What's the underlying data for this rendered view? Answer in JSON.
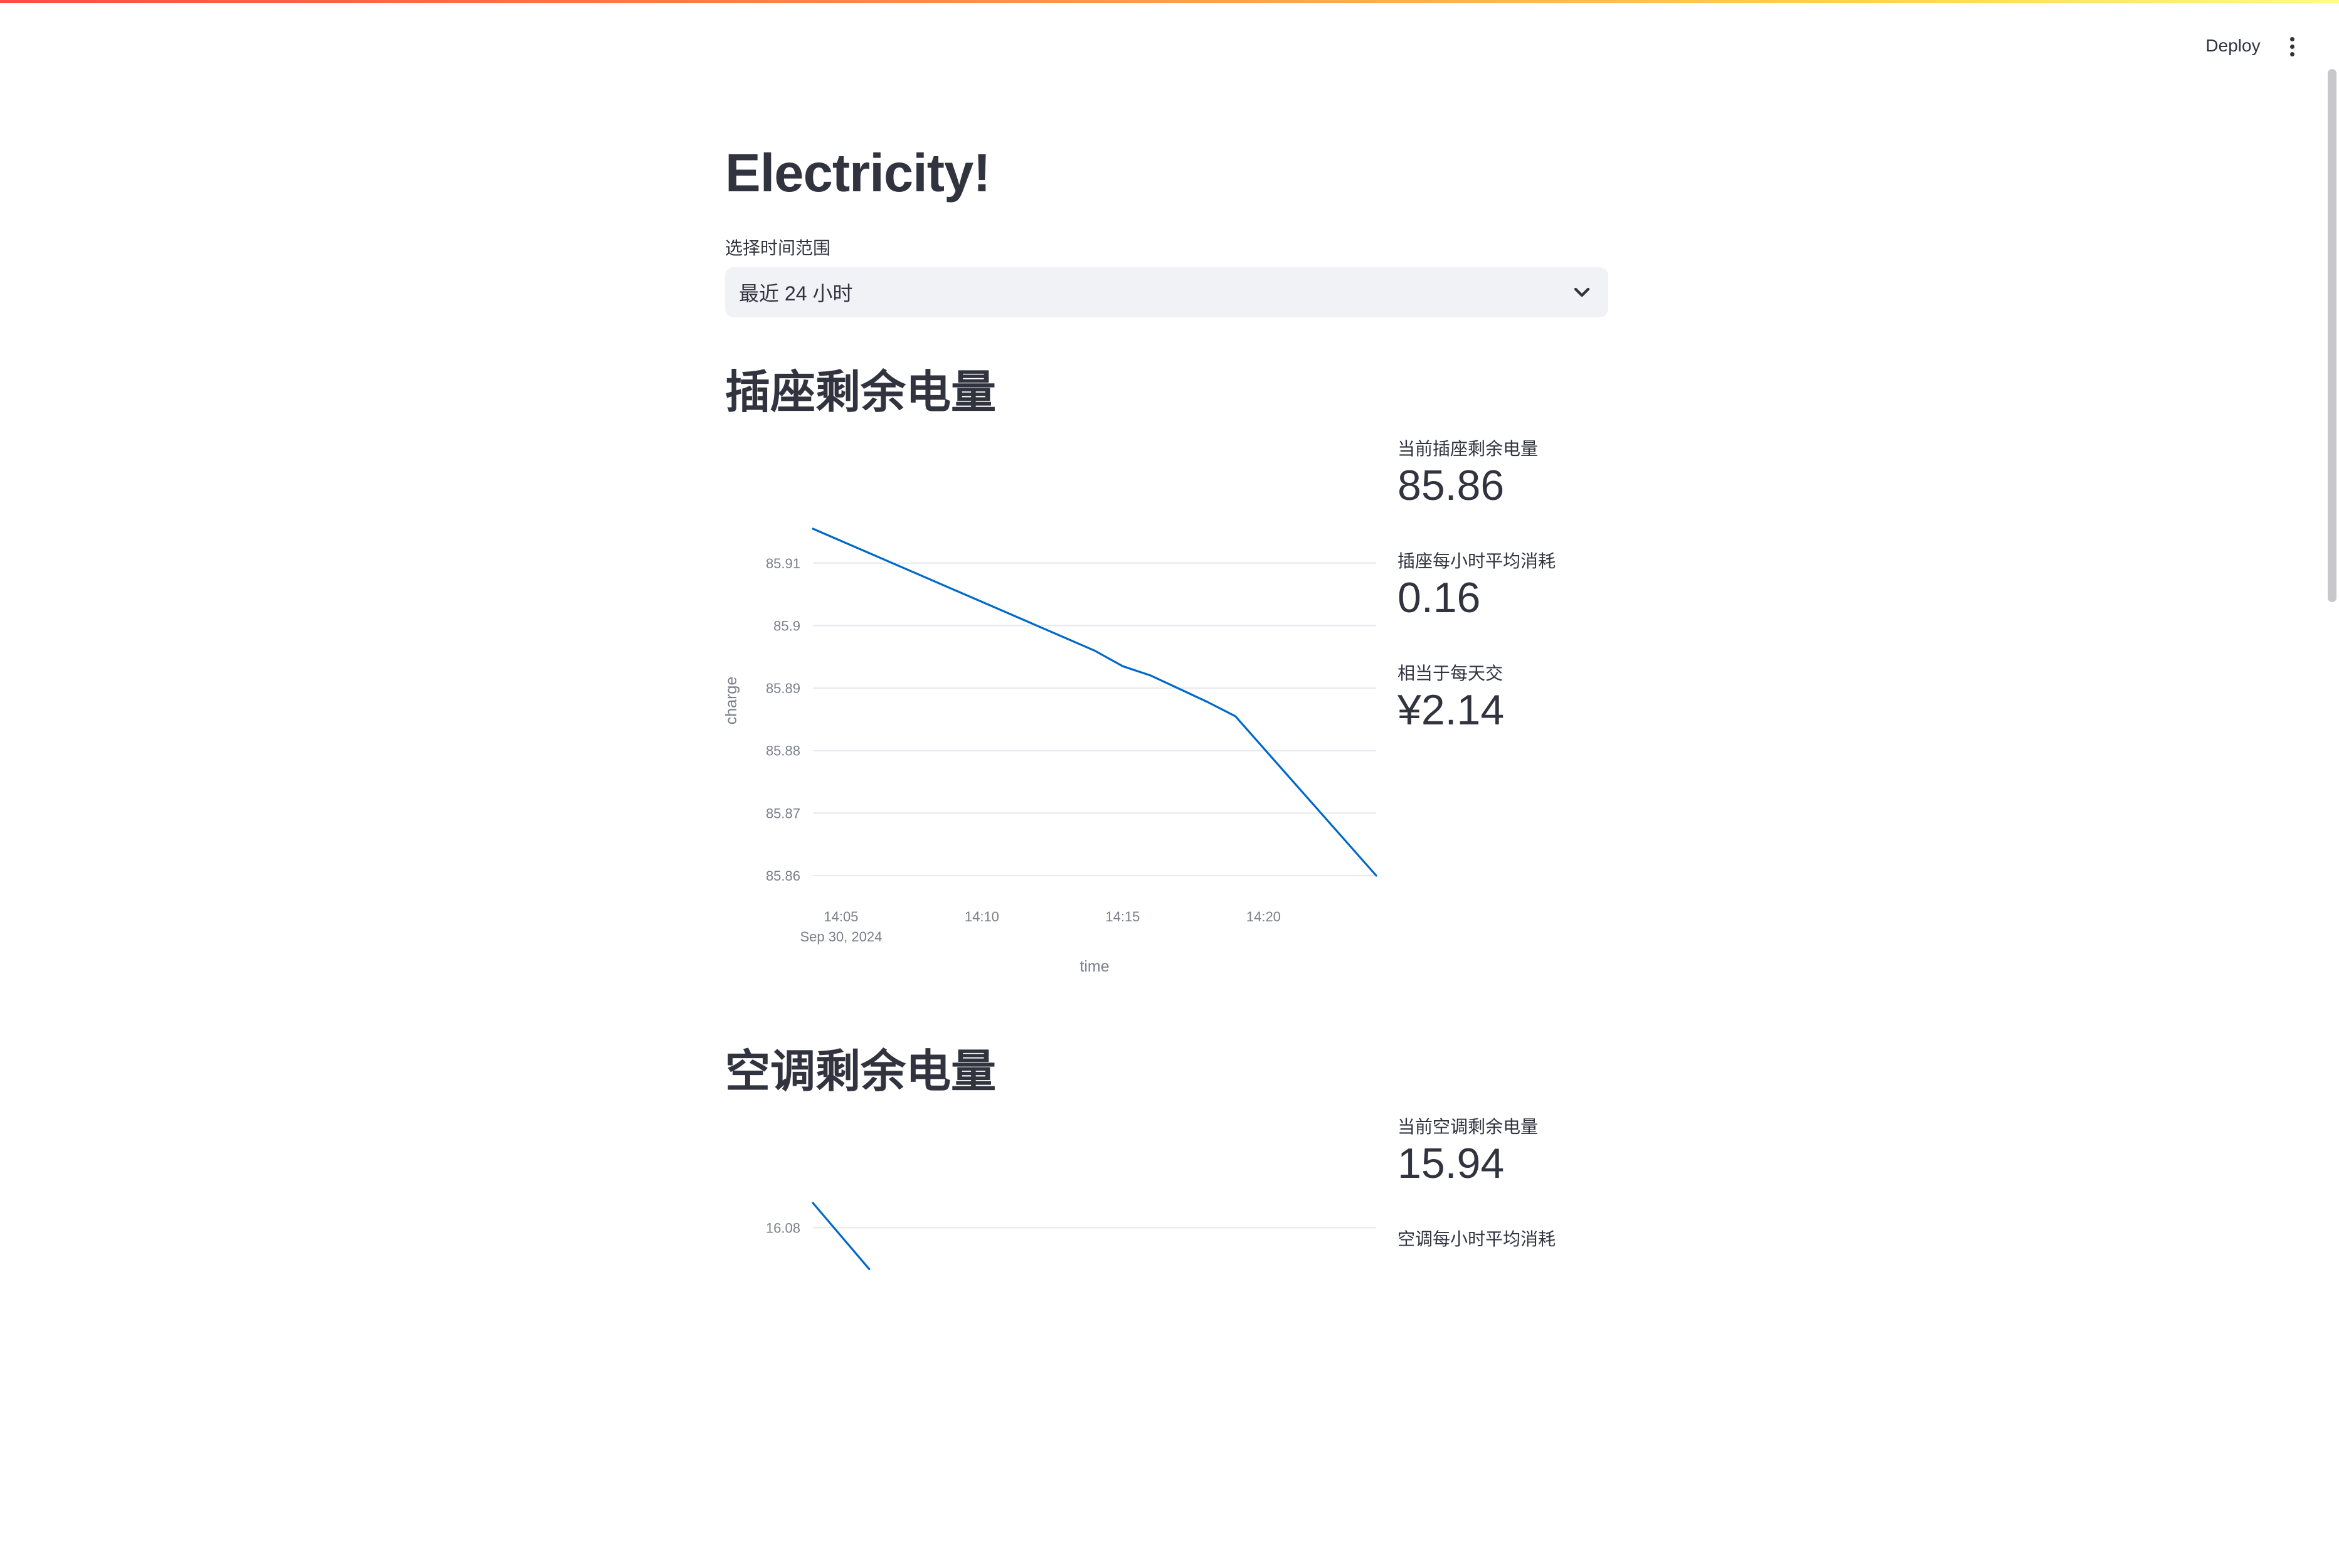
{
  "header": {
    "deploy_label": "Deploy",
    "menu_icon": "kebab-menu-icon"
  },
  "page": {
    "title": "Electricity!",
    "range_select": {
      "label": "选择时间范围",
      "value": "最近 24 小时"
    }
  },
  "sections": [
    {
      "heading": "插座剩余电量",
      "metrics": [
        {
          "label": "当前插座剩余电量",
          "value": "85.86"
        },
        {
          "label": "插座每小时平均消耗",
          "value": "0.16"
        },
        {
          "label": "相当于每天交",
          "value": "¥2.14"
        }
      ]
    },
    {
      "heading": "空调剩余电量",
      "metrics": [
        {
          "label": "当前空调剩余电量",
          "value": "15.94"
        },
        {
          "label": "空调每小时平均消耗",
          "value": ""
        }
      ]
    }
  ],
  "chart_data": [
    {
      "type": "line",
      "color": "#0068c9",
      "xlabel": "time",
      "ylabel": "charge",
      "date_label": "Sep 30, 2024",
      "x_ticks": [
        "14:05",
        "14:10",
        "14:15",
        "14:20"
      ],
      "y_ticks": [
        "85.86",
        "85.87",
        "85.88",
        "85.89",
        "85.9",
        "85.91"
      ],
      "ylim": [
        85.86,
        85.916
      ],
      "xlim": [
        "14:04",
        "14:24"
      ],
      "grid": true,
      "series": [
        {
          "x": [
            "14:04",
            "14:08",
            "14:12",
            "14:14",
            "14:15",
            "14:16",
            "14:18",
            "14:19",
            "14:24"
          ],
          "y": [
            85.9155,
            85.9077,
            85.8999,
            85.896,
            85.8935,
            85.892,
            85.8878,
            85.8855,
            85.86
          ]
        }
      ]
    },
    {
      "type": "line",
      "color": "#0068c9",
      "y_ticks": [
        "16.08"
      ],
      "ylim": [
        15.94,
        16.086
      ],
      "xlim": [
        "14:04",
        "14:24"
      ],
      "grid": true,
      "series": [
        {
          "x": [
            "14:04",
            "14:06"
          ],
          "y": [
            16.086,
            16.07
          ]
        }
      ]
    }
  ]
}
